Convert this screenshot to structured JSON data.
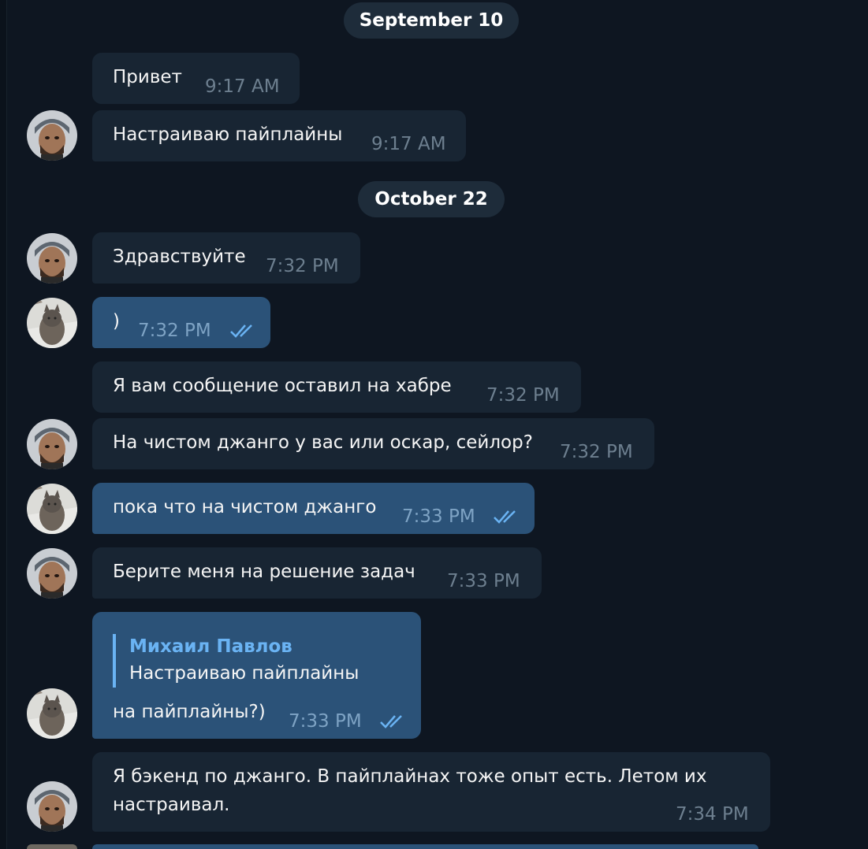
{
  "dates": [
    "September 10",
    "October 22"
  ],
  "messages": [
    {
      "text": "Привет",
      "time": "9:17 AM",
      "dir": "in"
    },
    {
      "text": "Настраиваю пайплайны",
      "time": "9:17 AM",
      "dir": "in"
    },
    {
      "text": "Здравствуйте",
      "time": "7:32 PM",
      "dir": "in"
    },
    {
      "text": ")",
      "time": "7:32 PM",
      "dir": "out"
    },
    {
      "text": "Я вам сообщение оставил на хабре",
      "time": "7:32 PM",
      "dir": "in"
    },
    {
      "text": "На чистом джанго у вас или оскар, сейлор?",
      "time": "7:32 PM",
      "dir": "in"
    },
    {
      "text": "пока что на чистом джанго",
      "time": "7:33 PM",
      "dir": "out"
    },
    {
      "text": "Берите меня на решение задач",
      "time": "7:33 PM",
      "dir": "in"
    },
    {
      "text": "на пайплайны?)",
      "time": "7:33 PM",
      "dir": "out",
      "reply": {
        "author": "Михаил Павлов",
        "text": "Настраиваю пайплайны"
      }
    },
    {
      "text": "Я бэкенд по джанго. В пайплайнах тоже опыт есть. Летом их",
      "text2": "настраивал.",
      "time": "7:34 PM",
      "dir": "in"
    }
  ],
  "icons": {
    "read_receipt": "double-check-icon",
    "avatar_other": "man-avatar",
    "avatar_self": "cat-avatar"
  },
  "colors": {
    "background": "#0e1621",
    "incoming_bubble": "#182533",
    "outgoing_bubble": "#2b5278",
    "accent": "#6ab3f3"
  }
}
